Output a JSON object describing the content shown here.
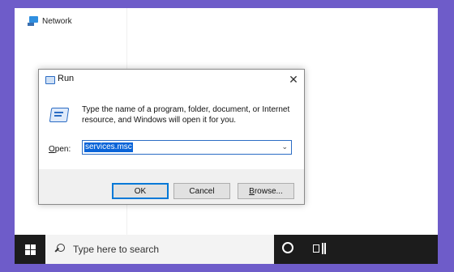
{
  "desktop": {
    "network_label": "Network"
  },
  "run_dialog": {
    "title": "Run",
    "close_glyph": "✕",
    "description": "Type the name of a program, folder, document, or Internet resource, and Windows will open it for you.",
    "open_label_prefix": "O",
    "open_label_rest": "pen:",
    "open_value": "services.msc",
    "combo_arrow": "⌄",
    "buttons": {
      "ok": "OK",
      "cancel": "Cancel",
      "browse_underlined": "B",
      "browse_rest": "rowse..."
    }
  },
  "taskbar": {
    "search_placeholder": "Type here to search"
  },
  "colors": {
    "background": "#6e5cc9",
    "accent": "#0078d7",
    "selection": "#0a64d8",
    "taskbar": "#1c1c1c"
  },
  "icons": [
    "network-icon",
    "run-icon",
    "close-icon",
    "dropdown-arrow-icon",
    "windows-logo-icon",
    "search-icon",
    "cortana-icon",
    "task-view-icon"
  ]
}
